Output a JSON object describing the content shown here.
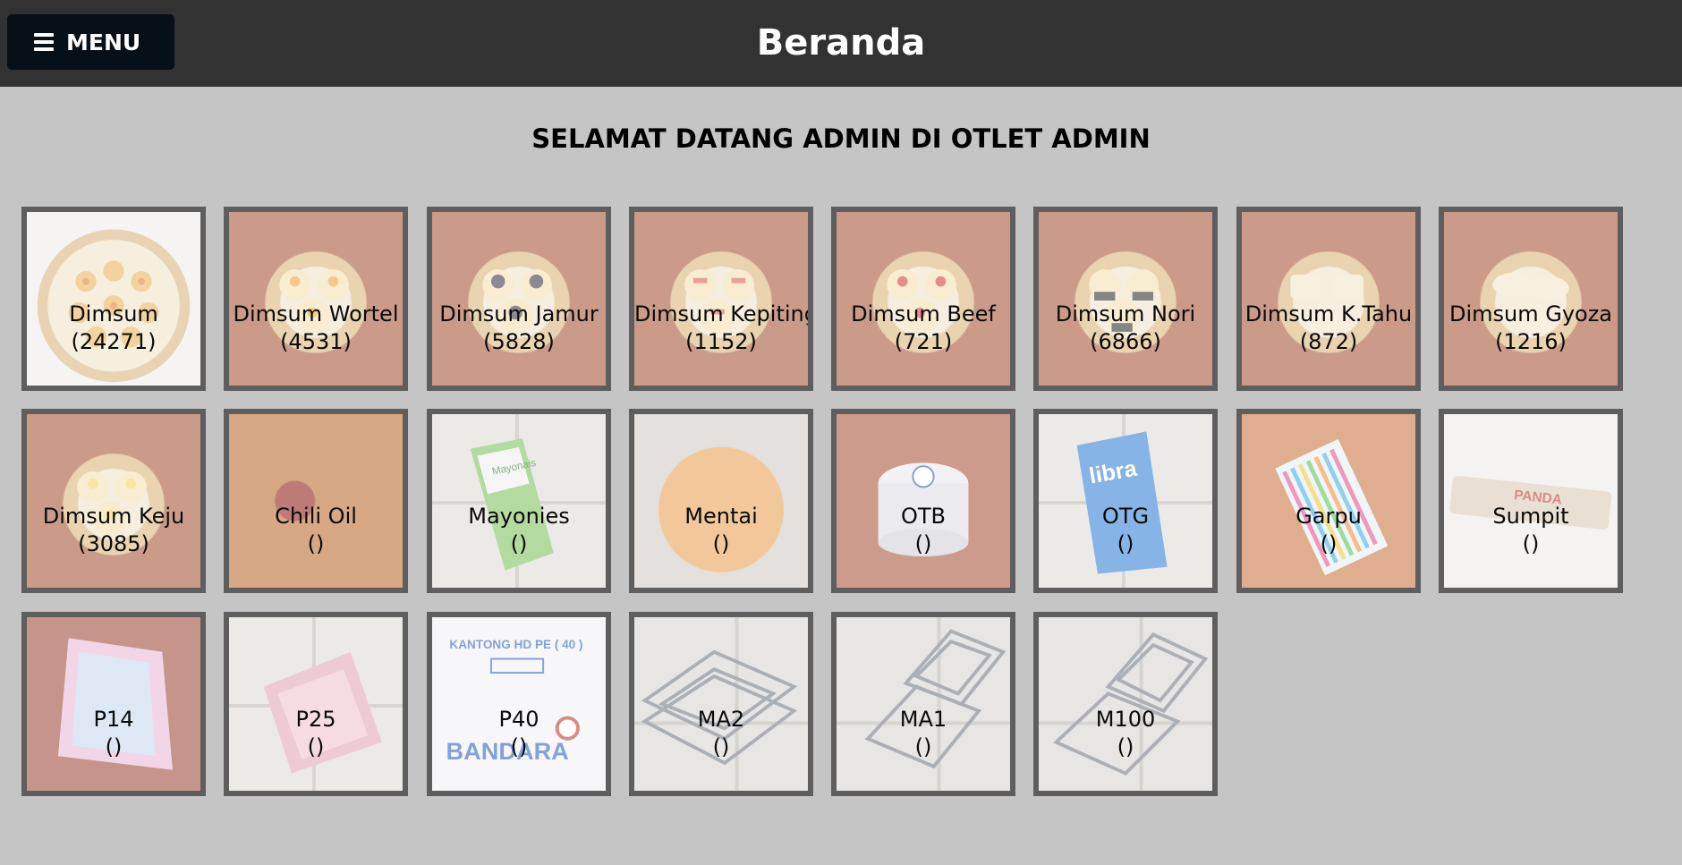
{
  "header": {
    "menu_label": "MENU",
    "title": "Beranda"
  },
  "welcome": "SELAMAT DATANG ADMIN DI OTLET ADMIN",
  "products": [
    {
      "name": "Dimsum",
      "count": "(24271)",
      "photo": "steamer-basket-icon"
    },
    {
      "name": "Dimsum Wortel",
      "count": "(4531)",
      "photo": "steamer-basket-icon"
    },
    {
      "name": "Dimsum Jamur",
      "count": "(5828)",
      "photo": "steamer-basket-icon"
    },
    {
      "name": "Dimsum Kepiting",
      "count": "(1152)",
      "photo": "steamer-basket-icon"
    },
    {
      "name": "Dimsum Beef",
      "count": "(721)",
      "photo": "steamer-basket-icon"
    },
    {
      "name": "Dimsum Nori",
      "count": "(6866)",
      "photo": "steamer-basket-icon"
    },
    {
      "name": "Dimsum K.Tahu",
      "count": "(872)",
      "photo": "steamer-basket-icon"
    },
    {
      "name": "Dimsum Gyoza",
      "count": "(1216)",
      "photo": "steamer-basket-icon"
    },
    {
      "name": "Dimsum Keju",
      "count": "(3085)",
      "photo": "steamer-basket-icon"
    },
    {
      "name": "Chili Oil",
      "count": "()",
      "photo": "chili-oil-icon"
    },
    {
      "name": "Mayonies",
      "count": "()",
      "photo": "mayonnaise-pouch-icon"
    },
    {
      "name": "Mentai",
      "count": "()",
      "photo": "mentai-sauce-icon"
    },
    {
      "name": "OTB",
      "count": "()",
      "photo": "plastic-container-icon"
    },
    {
      "name": "OTG",
      "count": "()",
      "photo": "container-bag-icon"
    },
    {
      "name": "Garpu",
      "count": "()",
      "photo": "fork-pack-icon"
    },
    {
      "name": "Sumpit",
      "count": "()",
      "photo": "chopsticks-pack-icon"
    },
    {
      "name": "P14",
      "count": "()",
      "photo": "plastic-bag-icon"
    },
    {
      "name": "P25",
      "count": "()",
      "photo": "plastic-bag-icon"
    },
    {
      "name": "P40",
      "count": "()",
      "photo": "plastic-bag-icon"
    },
    {
      "name": "MA2",
      "count": "()",
      "photo": "clamshell-box-icon"
    },
    {
      "name": "MA1",
      "count": "()",
      "photo": "clamshell-box-icon"
    },
    {
      "name": "M100",
      "count": "()",
      "photo": "clamshell-box-icon"
    }
  ],
  "photo_text": {
    "mayonies_pack": "Mayonais",
    "otg_pack": "libra",
    "sumpit_pack": "PANDA",
    "p40_pack_top": "KANTONG HD PE ( 40 )",
    "p40_pack_bottom": "BANDARA"
  },
  "colors": {
    "topbar": "#323232",
    "menu_button": "#070f17",
    "page_bg": "#c5c5c5",
    "tile_border": "#5e5e5e"
  }
}
